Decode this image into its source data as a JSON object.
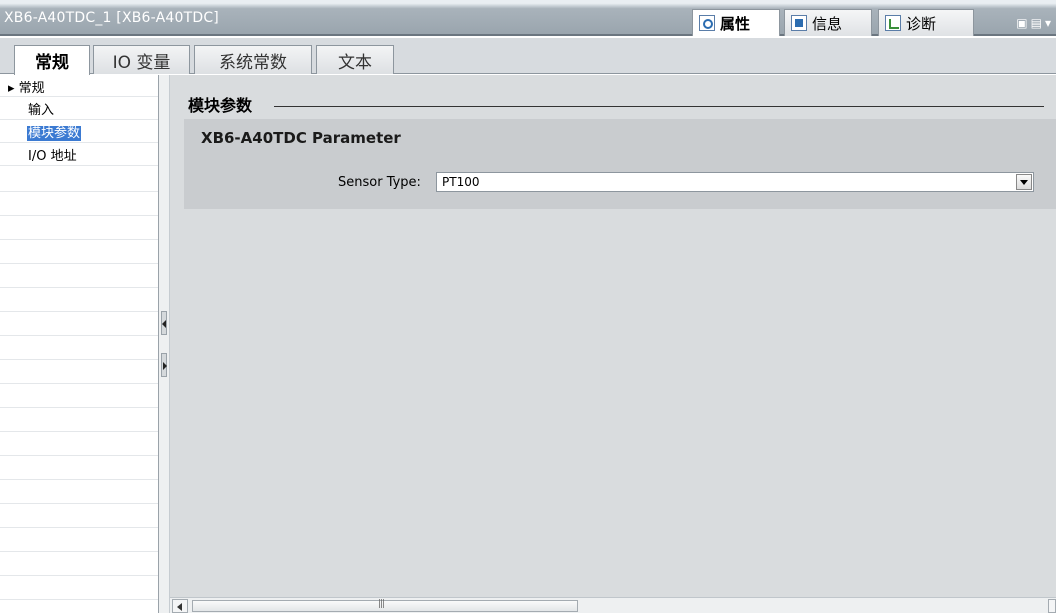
{
  "window": {
    "title": "XB6-A40TDC_1 [XB6-A40TDC]",
    "right_tabs": [
      {
        "label": "属性",
        "icon": "properties-icon",
        "active": true
      },
      {
        "label": "信息",
        "icon": "info-icon",
        "active": false
      },
      {
        "label": "诊断",
        "icon": "diagnostics-icon",
        "active": false
      }
    ]
  },
  "tabs": [
    {
      "label": "常规",
      "active": true
    },
    {
      "label": "IO 变量",
      "active": false
    },
    {
      "label": "系统常数",
      "active": false
    },
    {
      "label": "文本",
      "active": false
    }
  ],
  "nav": {
    "items": [
      {
        "label": "▸ 常规",
        "selected": false
      },
      {
        "label": "输入",
        "selected": false
      },
      {
        "label": "模块参数",
        "selected": true
      },
      {
        "label": "I/O 地址",
        "selected": false
      }
    ]
  },
  "main": {
    "section_heading": "模块参数",
    "panel_title": "XB6-A40TDC Parameter",
    "sensor_label": "Sensor Type:",
    "sensor_value": "PT100"
  },
  "colors": {
    "selection": "#3b7ad2",
    "panel_bg": "#c9cccf",
    "main_bg": "#d9dcde"
  }
}
